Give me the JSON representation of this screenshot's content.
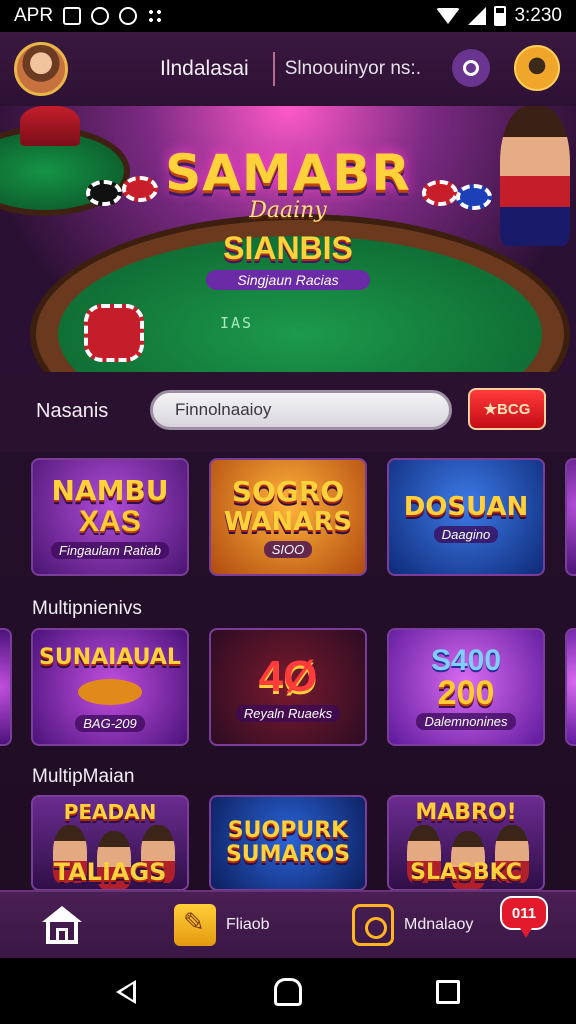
{
  "status_bar": {
    "left_text": "APR",
    "time": "3:230"
  },
  "header": {
    "app_name": "Ilndalasai",
    "search_text": "Slnoouinyor ns:.",
    "icons": [
      "avatar",
      "chat-icon",
      "user-icon"
    ]
  },
  "banner": {
    "title": "SAMABR",
    "subtitle": "Daainy",
    "center_title": "SIANBIS",
    "center_subtitle": "Singjaun Racias",
    "felt_text": "IAS"
  },
  "search_row": {
    "label": "Nasanis",
    "input_value": "Finnolnaaioy",
    "button_label": "★BCG"
  },
  "rows": [
    {
      "label": "",
      "tiles": [
        {
          "line1": "NAMBU",
          "line2": "XAS",
          "caption": "Fingaulam Ratiab"
        },
        {
          "line1": "SOGRO",
          "line2": "WANARS",
          "caption": "SIOO"
        },
        {
          "line1": "DOSUAN",
          "line2": "",
          "caption": "Daagino"
        }
      ]
    },
    {
      "label": "Multipnienivs",
      "tiles": [
        {
          "line1": "SUNAIAUAL",
          "line2": "",
          "caption": "BAG-209"
        },
        {
          "line1": "",
          "line2": "4Ø",
          "caption": "Reyaln Ruaeks"
        },
        {
          "line1": "S400",
          "line2": "200",
          "caption": "Dalemnonines"
        }
      ]
    },
    {
      "label": "MultipMaian",
      "tiles": [
        {
          "line1": "PEADAN",
          "line2": "TALIAGS",
          "caption": ""
        },
        {
          "line1": "SUOPURK",
          "line2": "SUMAROS",
          "caption": ""
        },
        {
          "line1": "MABRO!",
          "line2": "SLASBKC",
          "caption": ""
        }
      ]
    }
  ],
  "bottom_nav": {
    "item2_label": "Fliaob",
    "item3_label": "Mdnalaoy",
    "badge": "011"
  }
}
